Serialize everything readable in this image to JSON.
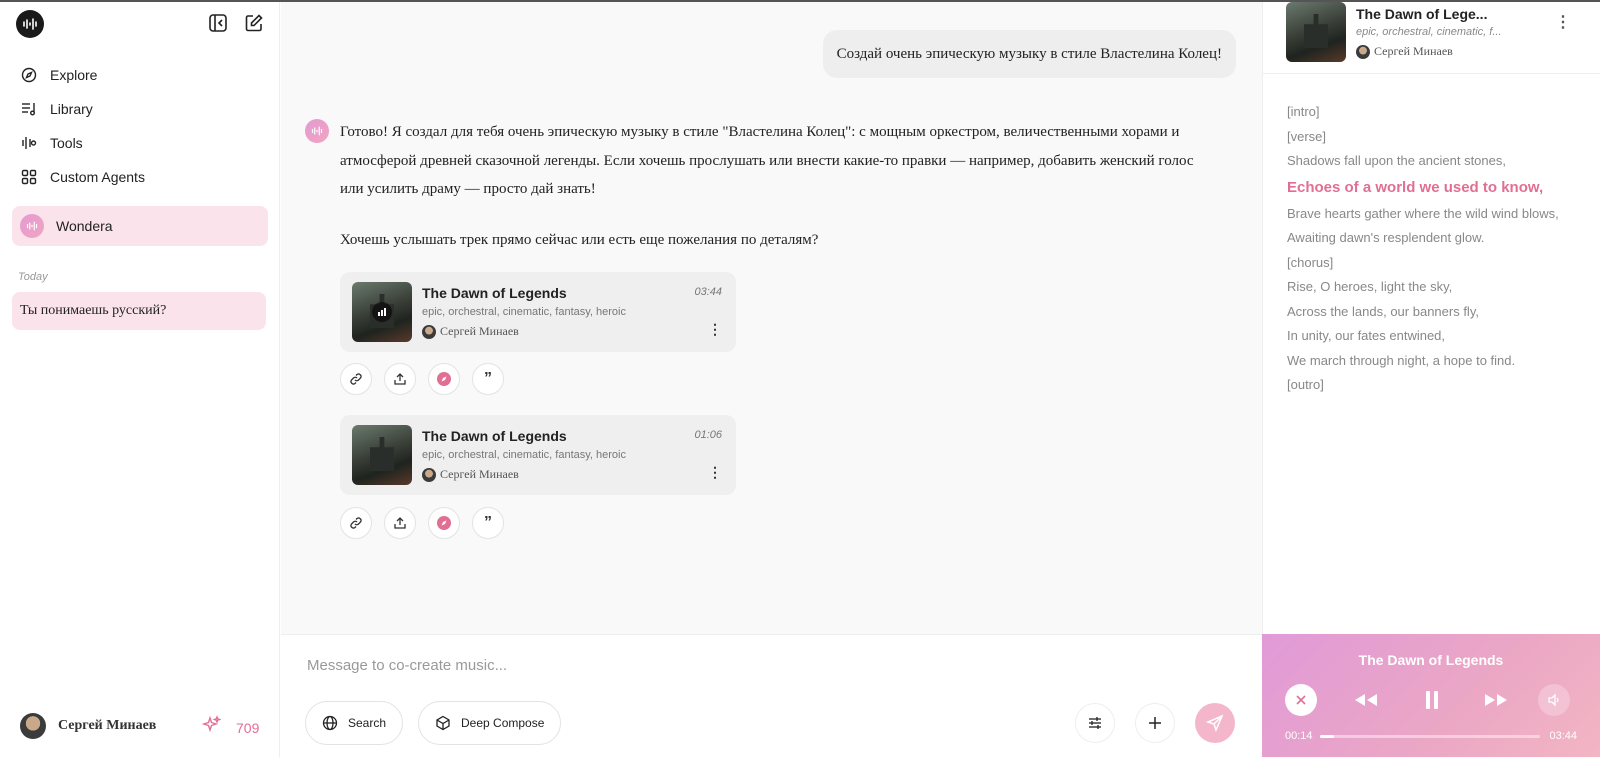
{
  "sidebar": {
    "nav": [
      {
        "label": "Explore",
        "icon": "compass-icon"
      },
      {
        "label": "Library",
        "icon": "library-icon"
      },
      {
        "label": "Tools",
        "icon": "tools-icon"
      },
      {
        "label": "Custom Agents",
        "icon": "grid-icon"
      }
    ],
    "agent": "Wondera",
    "history_group": "Today",
    "history": [
      "Ты понимаешь русский?"
    ],
    "user_name": "Сергей Минаев",
    "credits": "709"
  },
  "chat": {
    "user_message": "Создай очень эпическую музыку в стиле Властелина Колец!",
    "bot_message": "Готово! Я создал для тебя очень эпическую музыку в стиле \"Властелина Колец\": с мощным оркестром, величественными хорами и атмосферой древней сказочной легенды. Если хочешь прослушать или внести какие-то правки — например, добавить женский голос или усилить драму — просто дай знать!",
    "bot_question": "Хочешь услышать трек прямо сейчас или есть еще пожелания по деталям?",
    "tracks": [
      {
        "title": "The Dawn of Legends",
        "duration": "03:44",
        "tags": "epic, orchestral, cinematic, fantasy, heroic",
        "author": "Сергей Минаев"
      },
      {
        "title": "The Dawn of Legends",
        "duration": "01:06",
        "tags": "epic, orchestral, cinematic, fantasy, heroic",
        "author": "Сергей Минаев"
      }
    ]
  },
  "composer": {
    "placeholder": "Message to co-create music...",
    "search_label": "Search",
    "deep_compose_label": "Deep Compose"
  },
  "now_playing": {
    "title": "The Dawn of Lege...",
    "tags": "epic, orchestral, cinematic, f...",
    "author": "Сергей Минаев",
    "lyrics": [
      {
        "text": "[intro]",
        "active": false
      },
      {
        "text": "[verse]",
        "active": false
      },
      {
        "text": "Shadows fall upon the ancient stones,",
        "active": false
      },
      {
        "text": "Echoes of a world we used to know,",
        "active": true
      },
      {
        "text": "Brave hearts gather where the wild wind blows,",
        "active": false
      },
      {
        "text": "Awaiting dawn's resplendent glow.",
        "active": false
      },
      {
        "text": "[chorus]",
        "active": false
      },
      {
        "text": "Rise, O heroes, light the sky,",
        "active": false
      },
      {
        "text": "Across the lands, our banners fly,",
        "active": false
      },
      {
        "text": "In unity, our fates entwined,",
        "active": false
      },
      {
        "text": "We march through night, a hope to find.",
        "active": false
      },
      {
        "text": "[outro]",
        "active": false
      }
    ]
  },
  "player": {
    "title": "The Dawn of Legends",
    "current_time": "00:14",
    "total_time": "03:44",
    "progress": 0.063
  },
  "colors": {
    "accent": "#e26f93",
    "highlight_bg": "#fae3ea"
  }
}
